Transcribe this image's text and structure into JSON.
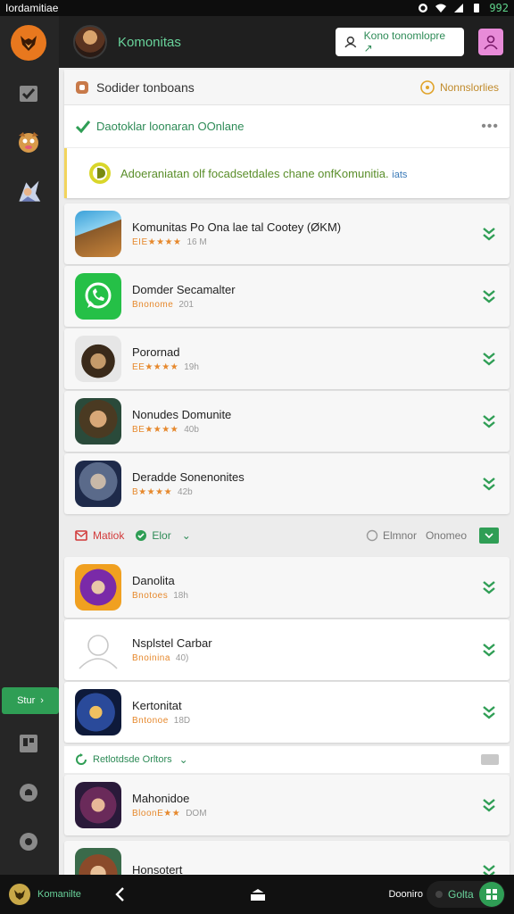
{
  "status_bar": {
    "app_label": "Iordamitiae",
    "time": "992"
  },
  "topbar": {
    "title": "Komonitas",
    "search_placeholder": "Kono tonomlopre ↗"
  },
  "sidebar": {
    "active_label": "Stur"
  },
  "featured_card": {
    "title": "Sodider tonboans",
    "badge_label": "Nonnslorlies",
    "check_text": "Daotoklar loonaran OOnlane",
    "more": "•••",
    "promo_text": "Adoeraniatan olf focadsetdales chane onfKomunitia.",
    "promo_link": "iats"
  },
  "apps": [
    {
      "name": "Komunitas Po Ona lae tal Cootey (ØKM)",
      "meta_a": "EIE★★★★",
      "meta_b": "16 M"
    },
    {
      "name": "Domder Secamalter",
      "meta_a": "Bnonome",
      "meta_b": "201"
    },
    {
      "name": "Porornad",
      "meta_a": "EE★★★★",
      "meta_b": "19h"
    },
    {
      "name": "Nonudes Domunite",
      "meta_a": "BE★★★★",
      "meta_b": "40b"
    },
    {
      "name": "Deradde Sonenonites",
      "meta_a": "B★★★★",
      "meta_b": "42b"
    },
    {
      "name": "Danolita",
      "meta_a": "Bnotoes",
      "meta_b": "18h"
    },
    {
      "name": "Nsplstel Carbar",
      "meta_a": "Bnoinina",
      "meta_b": "40)"
    },
    {
      "name": "Kertonitat",
      "meta_a": "Bntonoe",
      "meta_b": "18D"
    },
    {
      "name": "Mahonidoe",
      "meta_a": "BloonE★★",
      "meta_b": "DOM"
    },
    {
      "name": "Honsotert",
      "meta_a": "",
      "meta_b": ""
    }
  ],
  "section_1": {
    "left_label": "Matiok",
    "mid_label": "Elor",
    "right_a": "Elmnor",
    "right_b": "Onomeo"
  },
  "section_2": {
    "label": "Retlotdsde Orltors"
  },
  "bottom_bar": {
    "brand": "Komanilte",
    "right_label": "Dooniro",
    "action_label": "Golta"
  },
  "colors": {
    "accent_green": "#2f9e55",
    "text_green": "#2e8b57",
    "orange": "#e6882c"
  }
}
